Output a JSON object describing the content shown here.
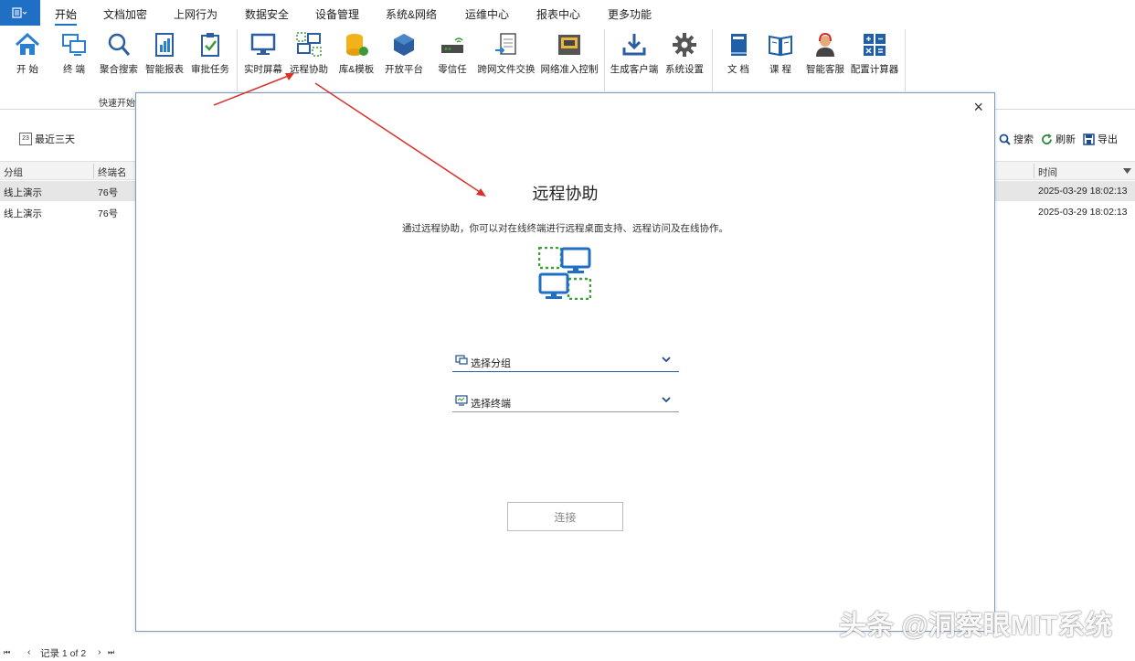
{
  "menubar": {
    "app_menu_icon": "menu-icon",
    "tabs": [
      "开始",
      "文档加密",
      "上网行为",
      "数据安全",
      "设备管理",
      "系统&网络",
      "运维中心",
      "报表中心",
      "更多功能"
    ]
  },
  "ribbon": {
    "buttons": [
      "开 始",
      "终 端",
      "聚合搜索",
      "智能报表",
      "审批任务",
      "实时屏幕",
      "远程协助",
      "库&模板",
      "开放平台",
      "零信任",
      "跨网文件交换",
      "网络准入控制",
      "生成客户端",
      "系统设置",
      "文 档",
      "课 程",
      "智能客服",
      "配置计算器"
    ],
    "group_label": "快速开始"
  },
  "list_toolbar": {
    "date_filter": "最近三天",
    "date_icon_text": "23",
    "search": "搜索",
    "refresh": "刷新",
    "export": "导出"
  },
  "grid": {
    "headers": {
      "group": "分组",
      "terminal": "终端名",
      "time": "时间"
    },
    "rows": [
      {
        "group": "线上演示",
        "terminal": "76号",
        "time": "2025-03-29 18:02:13"
      },
      {
        "group": "线上演示",
        "terminal": "76号",
        "time": "2025-03-29 18:02:13"
      }
    ]
  },
  "pager": {
    "first": "⏮",
    "prev": "‹",
    "text": "记录 1 of 2",
    "next": "›",
    "last": "⏭"
  },
  "dialog": {
    "close": "×",
    "title": "远程协助",
    "description": "通过远程协助，你可以对在线终端进行远程桌面支持、远程访问及在线协作。",
    "select_group_placeholder": "选择分组",
    "select_terminal_placeholder": "选择终端",
    "connect_label": "连接"
  },
  "watermark": "头条 @洞察眼MIT系统",
  "colors": {
    "accent": "#1f6fc5",
    "arrow": "#d8322a",
    "selected_row": "#e6e6e6"
  }
}
